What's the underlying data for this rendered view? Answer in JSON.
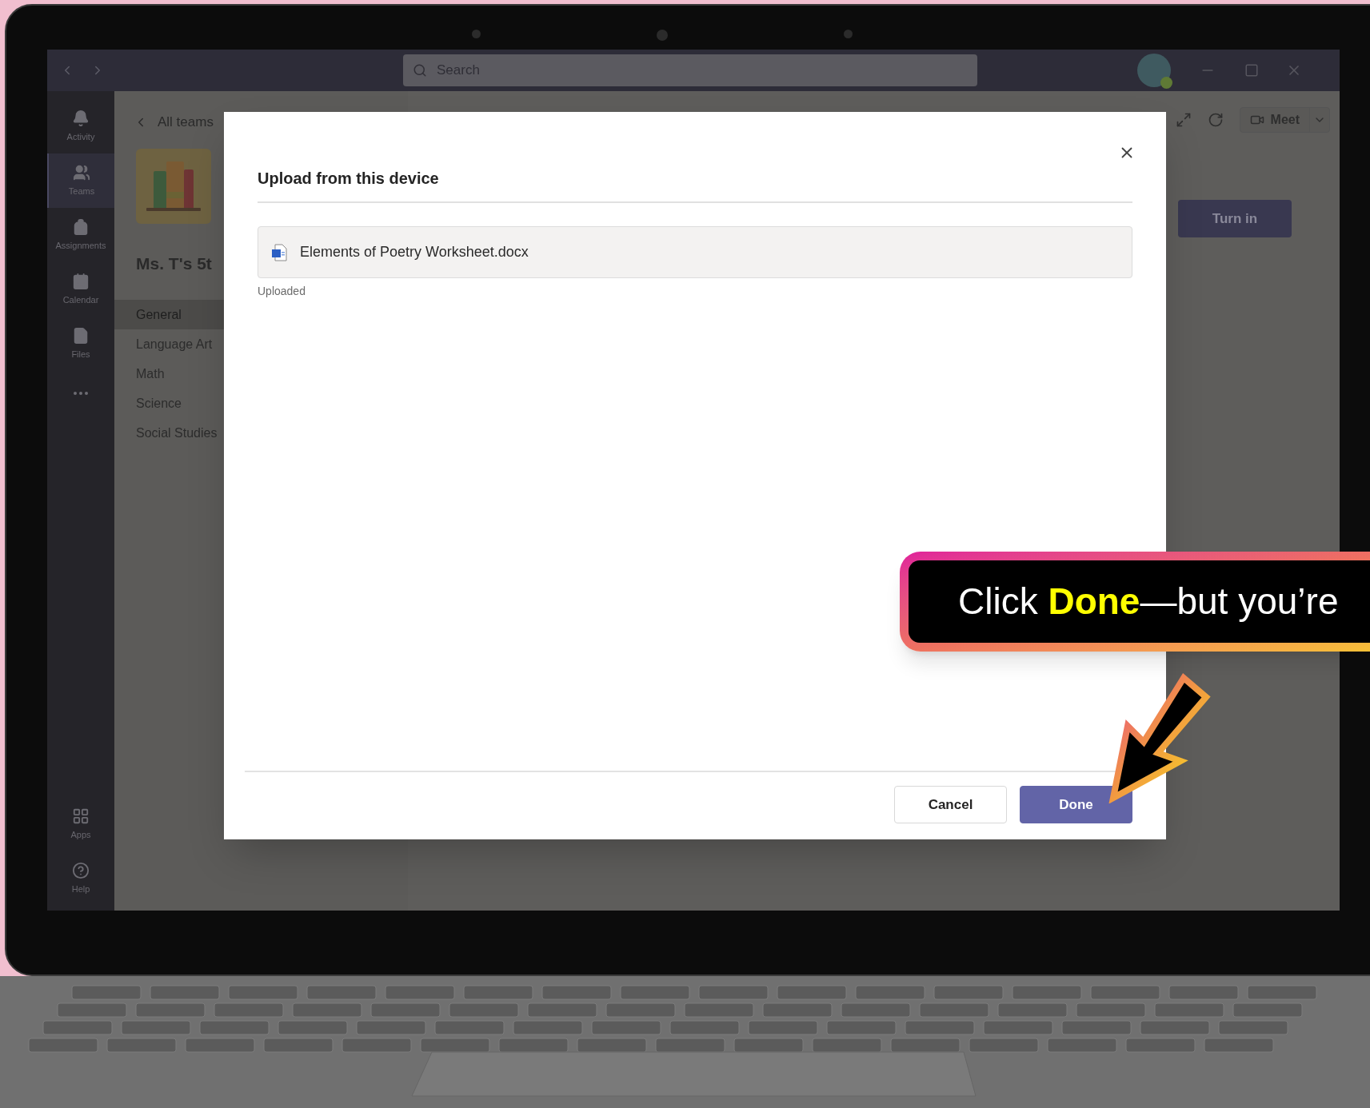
{
  "title_bar": {
    "search": {
      "placeholder": "Search"
    }
  },
  "rail": [
    {
      "label": "Activity",
      "selected": false
    },
    {
      "label": "Teams",
      "selected": true
    },
    {
      "label": "Assignments",
      "selected": false
    },
    {
      "label": "Calendar",
      "selected": false
    },
    {
      "label": "Files",
      "selected": false
    }
  ],
  "rail_bottom": [
    {
      "label": "Apps"
    },
    {
      "label": "Help"
    }
  ],
  "team_panel": {
    "back_label": "All teams",
    "team_name": "Ms. T's 5t",
    "channels": [
      {
        "label": "General",
        "selected": true
      },
      {
        "label": "Language Art",
        "selected": false
      },
      {
        "label": "Math",
        "selected": false
      },
      {
        "label": "Science",
        "selected": false
      },
      {
        "label": "Social Studies",
        "selected": false
      }
    ]
  },
  "toolbar": {
    "meet_label": "Meet"
  },
  "turn_in": "Turn in",
  "dialog": {
    "title": "Upload from this device",
    "files": [
      {
        "name": "Elements of Poetry Worksheet.docx",
        "status": "Uploaded"
      }
    ],
    "buttons": [
      {
        "label": "Cancel",
        "kind": "secondary"
      },
      {
        "label": "Done",
        "kind": "primary"
      }
    ]
  },
  "callout": {
    "text": "Click **Done**—but you’re"
  }
}
